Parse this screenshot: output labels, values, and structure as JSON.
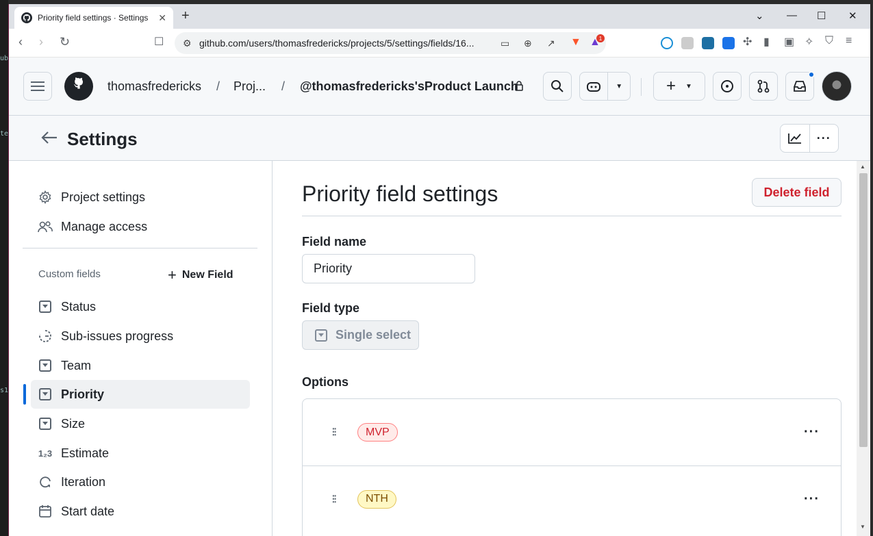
{
  "browser": {
    "tab_title": "Priority field settings · Settings",
    "new_tab": "+",
    "url": "github.com/users/thomasfredericks/projects/5/settings/fields/16...",
    "extension_badge": "1"
  },
  "header": {
    "breadcrumbs": [
      "thomasfredericks",
      "Proj...",
      "@thomasfredericks'sProduct Launch"
    ],
    "separator": "/"
  },
  "settings_bar": {
    "title": "Settings"
  },
  "sidebar": {
    "top_items": [
      {
        "label": "Project settings",
        "icon": "gear-icon"
      },
      {
        "label": "Manage access",
        "icon": "people-icon"
      }
    ],
    "custom_fields_label": "Custom fields",
    "new_field_label": "New Field",
    "fields": [
      {
        "label": "Status",
        "icon": "single-select-icon"
      },
      {
        "label": "Sub-issues progress",
        "icon": "progress-icon"
      },
      {
        "label": "Team",
        "icon": "single-select-icon"
      },
      {
        "label": "Priority",
        "icon": "single-select-icon",
        "active": true
      },
      {
        "label": "Size",
        "icon": "single-select-icon"
      },
      {
        "label": "Estimate",
        "icon": "number-icon"
      },
      {
        "label": "Iteration",
        "icon": "iteration-icon"
      },
      {
        "label": "Start date",
        "icon": "calendar-icon"
      }
    ]
  },
  "main": {
    "title": "Priority field settings",
    "delete_label": "Delete field",
    "field_name_label": "Field name",
    "field_name_value": "Priority",
    "field_type_label": "Field type",
    "field_type_value": "Single select",
    "options_label": "Options",
    "options": [
      {
        "label": "MVP",
        "color": "#cf222e"
      },
      {
        "label": "NTH",
        "color": "#9a6700"
      }
    ]
  }
}
